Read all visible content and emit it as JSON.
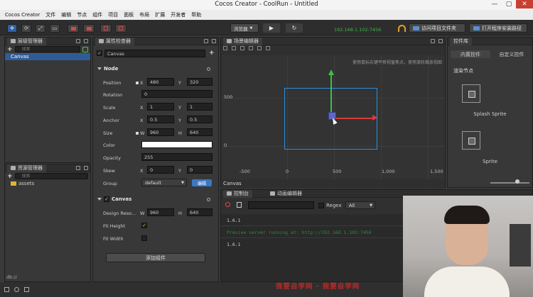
{
  "window": {
    "title": "Cocos Creator - CoolRun - Untitled",
    "controls": [
      "—",
      "▢",
      "✕"
    ]
  },
  "menu": [
    "Cocos Creator",
    "文件",
    "编辑",
    "节点",
    "组件",
    "项目",
    "面板",
    "布局",
    "扩展",
    "开发者",
    "帮助"
  ],
  "toolbar": {
    "browser_label": "浏览器",
    "play_icon": "play-icon",
    "refresh_icon": "refresh-icon",
    "ip_text": "192.168.1.102:7456",
    "btn_open_project": "访问项目文件夹",
    "btn_open_install": "打开程序安装路径"
  },
  "hierarchy": {
    "title": "层级管理器",
    "search_placeholder": "搜索",
    "items": [
      "Canvas"
    ]
  },
  "assets": {
    "title": "资源管理器",
    "search_placeholder": "搜索",
    "items": [
      "assets"
    ],
    "path": "db://"
  },
  "inspector": {
    "title": "属性检查器",
    "node_name": "Canvas",
    "node_section": "Node",
    "position": {
      "label": "Position",
      "x": "480",
      "y": "320"
    },
    "rotation": {
      "label": "Rotation",
      "value": "0"
    },
    "scale": {
      "label": "Scale",
      "x": "1",
      "y": "1"
    },
    "anchor": {
      "label": "Anchor",
      "x": "0.5",
      "y": "0.5"
    },
    "size": {
      "label": "Size",
      "w": "960",
      "h": "640"
    },
    "color": {
      "label": "Color",
      "value": "#ffffff"
    },
    "opacity": {
      "label": "Opacity",
      "value": "255"
    },
    "skew": {
      "label": "Skew",
      "x": "0",
      "y": "0"
    },
    "group": {
      "label": "Group",
      "value": "default",
      "edit": "编辑"
    },
    "canvas_section": "Canvas",
    "design_resolution": {
      "label": "Design Reso...",
      "w": "960",
      "h": "640"
    },
    "fit_height": {
      "label": "Fit Height",
      "checked": true
    },
    "fit_width": {
      "label": "Fit Width",
      "checked": false
    },
    "add_component": "添加组件",
    "axis_x": "X",
    "axis_y": "Y",
    "axis_w": "W",
    "axis_h": "H"
  },
  "scene": {
    "title": "场景编辑器",
    "hint": "使用鼠标右键平移视窗焦点，使用滚轮缩放视图",
    "y_ticks": [
      "500",
      "0"
    ],
    "x_ticks": [
      "-500",
      "0",
      "500",
      "1,000",
      "1,500"
    ],
    "footer": "Canvas"
  },
  "console": {
    "tab_console": "控制台",
    "tab_animation": "动画编辑器",
    "regex_label": "Regex",
    "filter_value": "All",
    "lines": [
      {
        "text": "1.6.1",
        "color": "#cfcfcf"
      },
      {
        "text": "Preview server running at: http://192.168.1.102:7456",
        "color": "#2e8b3a"
      },
      {
        "text": "1.6.1",
        "color": "#cfcfcf"
      }
    ]
  },
  "library": {
    "title": "控件库",
    "tab_builtin": "内置控件",
    "tab_custom": "自定义控件",
    "section": "渲染节点",
    "items": [
      "Splash Sprite",
      "Sprite"
    ]
  },
  "watermark": "我要自学网 · 我要自学网",
  "colors": {
    "accent_blue": "#2d5fa3",
    "gizmo_green": "#3fbf4a",
    "gizmo_red": "#d93a3a",
    "design_rect": "#2d8fe0"
  }
}
